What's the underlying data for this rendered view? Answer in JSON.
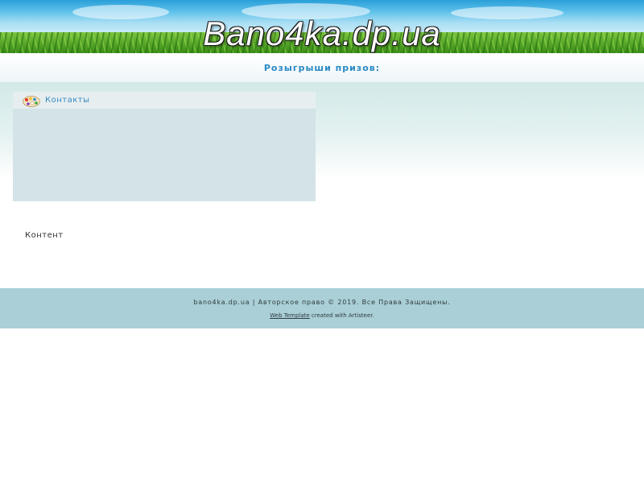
{
  "header": {
    "site_title": "Bano4ka.dp.ua"
  },
  "nav": {
    "items": [
      {
        "label": "Розыгрыши призов:"
      }
    ]
  },
  "block": {
    "title": "Контакты",
    "icon": "palette-icon"
  },
  "main": {
    "content": "Контент"
  },
  "footer": {
    "copyright": "bano4ka.dp.ua | Авторское право © 2019. Все Права Защищены.",
    "credit_link": "Web Template",
    "credit_suffix": " created with Artisteer."
  },
  "colors": {
    "accent": "#2a8ac4",
    "footer_bg": "#aacfd6",
    "block_bg": "#d4e3e7"
  }
}
